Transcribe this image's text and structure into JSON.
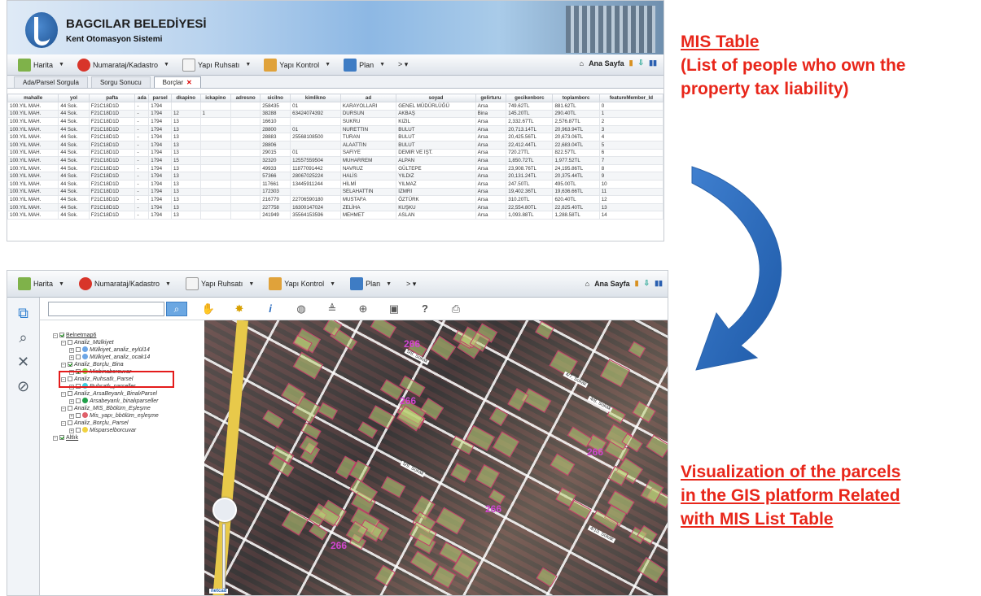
{
  "app": {
    "org": "BAGCILAR BELEDİYESİ",
    "subtitle": "Kent Otomasyon Sistemi"
  },
  "toolbar": {
    "items": [
      {
        "label": "Harita",
        "icon": "map-icon",
        "color": "#7fb24a"
      },
      {
        "label": "Numarataj/Kadastro",
        "icon": "pin-icon",
        "color": "#d8352a"
      },
      {
        "label": "Yapı Ruhsatı",
        "icon": "document-icon",
        "color": "#f4f4f4"
      },
      {
        "label": "Yapı Kontrol",
        "icon": "building-icon",
        "color": "#e0a23a"
      },
      {
        "label": "Plan",
        "icon": "plan-icon",
        "color": "#3e7cc4"
      }
    ],
    "more": "> ▾",
    "home": "Ana Sayfa"
  },
  "tabs": [
    "Ada/Parsel Sorgula",
    "Sorgu Sonucu",
    "Borçlar"
  ],
  "table": {
    "columns": [
      "mahalle",
      "yol",
      "pafta",
      "ada",
      "parsel",
      "dkapino",
      "ickapino",
      "adresno",
      "sicilno",
      "kimlikno",
      "ad",
      "soyad",
      "gelirturu",
      "gecikenborc",
      "toplamborc",
      "featureMember_Id"
    ],
    "rows": [
      [
        "100.YIL MAH.",
        "44 Sok.",
        "F21C18D1D",
        "-",
        "1794",
        "",
        "",
        "",
        "258435",
        "01",
        "KARAYOLLARI",
        "GENEL MÜDÜRLÜĞÜ",
        "Arsa",
        "749.62TL",
        "881.62TL",
        "0"
      ],
      [
        "100.YIL MAH.",
        "44 Sok.",
        "F21C18D1D",
        "-",
        "1794",
        "12",
        "1",
        "",
        "38288",
        "63424074392",
        "DURSUN",
        "AKBAŞ",
        "Bina",
        "145.20TL",
        "290.40TL",
        "1"
      ],
      [
        "100.YIL MAH.",
        "44 Sok.",
        "F21C18D1D",
        "-",
        "1794",
        "13",
        "",
        "",
        "16610",
        "",
        "SUKRU",
        "KIZIL",
        "Arsa",
        "2,332.67TL",
        "2,576.87TL",
        "2"
      ],
      [
        "100.YIL MAH.",
        "44 Sok.",
        "F21C18D1D",
        "-",
        "1794",
        "13",
        "",
        "",
        "28800",
        "01",
        "NURETTIN",
        "BULUT",
        "Arsa",
        "20,713.14TL",
        "20,963.94TL",
        "3"
      ],
      [
        "100.YIL MAH.",
        "44 Sok.",
        "F21C18D1D",
        "-",
        "1794",
        "13",
        "",
        "",
        "28883",
        "25568108500",
        "TURAN",
        "BULUT",
        "Arsa",
        "20,425.56TL",
        "20,673.06TL",
        "4"
      ],
      [
        "100.YIL MAH.",
        "44 Sok.",
        "F21C18D1D",
        "-",
        "1794",
        "13",
        "",
        "",
        "28806",
        "",
        "ALAATTIN",
        "BULUT",
        "Arsa",
        "22,412.44TL",
        "22,683.04TL",
        "5"
      ],
      [
        "100.YIL MAH.",
        "44 Sok.",
        "F21C18D1D",
        "-",
        "1794",
        "13",
        "",
        "",
        "29015",
        "01",
        "SAFIYE",
        "DEMİR VE İŞT.",
        "Arsa",
        "720.27TL",
        "822.57TL",
        "6"
      ],
      [
        "100.YIL MAH.",
        "44 Sok.",
        "F21C18D1D",
        "-",
        "1794",
        "15",
        "",
        "",
        "32320",
        "12557559504",
        "MUHARREM",
        "ALPAN",
        "Arsa",
        "1,850.72TL",
        "1,977.52TL",
        "7"
      ],
      [
        "100.YIL MAH.",
        "44 Sok.",
        "F21C18D1D",
        "-",
        "1794",
        "13",
        "",
        "",
        "49933",
        "11877091442",
        "NAVRUZ",
        "GÜLTEPE",
        "Arsa",
        "23,908.76TL",
        "24,195.86TL",
        "8"
      ],
      [
        "100.YIL MAH.",
        "44 Sok.",
        "F21C18D1D",
        "-",
        "1794",
        "13",
        "",
        "",
        "57366",
        "28067025224",
        "HALİS",
        "YILDIZ",
        "Arsa",
        "20,131.24TL",
        "20,375.44TL",
        "9"
      ],
      [
        "100.YIL MAH.",
        "44 Sok.",
        "F21C18D1D",
        "-",
        "1794",
        "13",
        "",
        "",
        "117661",
        "13445911244",
        "HİLMİ",
        "YILMAZ",
        "Arsa",
        "247.50TL",
        "495.00TL",
        "10"
      ],
      [
        "100.YIL MAH.",
        "44 Sok.",
        "F21C18D1D",
        "-",
        "1794",
        "13",
        "",
        "",
        "172303",
        "",
        "SELAHATTIN",
        "İZMRİ",
        "Arsa",
        "19,402.36TL",
        "19,636.66TL",
        "11"
      ],
      [
        "100.YIL MAH.",
        "44 Sok.",
        "F21C18D1D",
        "-",
        "1794",
        "13",
        "",
        "",
        "216779",
        "22706590180",
        "MUSTAFA",
        "ÖZTÜRK",
        "Arsa",
        "310.20TL",
        "620.40TL",
        "12"
      ],
      [
        "100.YIL MAH.",
        "44 Sok.",
        "F21C18D1D",
        "-",
        "1794",
        "13",
        "",
        "",
        "227758",
        "16300147024",
        "ZELİHA",
        "KUŞKU",
        "Arsa",
        "22,554.80TL",
        "22,825.40TL",
        "13"
      ],
      [
        "100.YIL MAH.",
        "44 Sok.",
        "F21C18D1D",
        "-",
        "1794",
        "13",
        "",
        "",
        "241949",
        "35564153596",
        "MEHMET",
        "ASLAN",
        "Arsa",
        "1,093.88TL",
        "1,288.58TL",
        "14"
      ]
    ]
  },
  "notes": {
    "t1_line1": "MIS Table",
    "t1_line2": "(List of people who own the",
    "t1_line3": "property tax liability)",
    "t2_line1": "Visualization of the parcels",
    "t2_line2": "in the GIS platform Related",
    "t2_line3": "with MIS  List Table"
  },
  "tree": [
    {
      "text": "Belnetmap6",
      "level": 0,
      "checked": true,
      "root": true
    },
    {
      "text": "Analiz_Mülkiyet",
      "level": 1,
      "checked": false
    },
    {
      "text": "Mülkiyet_analiz_eylül14",
      "level": 2,
      "checked": false,
      "color": "#6da6e6"
    },
    {
      "text": "Mülkiyet_analiz_ocak14",
      "level": 2,
      "checked": false,
      "color": "#6da6e6"
    },
    {
      "text": "Analiz_Borçlu_Bina",
      "level": 1,
      "checked": true
    },
    {
      "text": "Misbinaborcuvar",
      "level": 2,
      "checked": true,
      "color": "#8bd24c"
    },
    {
      "text": "Analiz_Ruhsatlı_Parsel",
      "level": 1,
      "checked": false
    },
    {
      "text": "Ruhsatlı_parseller",
      "level": 2,
      "checked": false,
      "color": "#3fd0e0"
    },
    {
      "text": "Analiz_ArsaBeyanlı_BinalıParsel",
      "level": 1,
      "checked": false
    },
    {
      "text": "Arsabeyanlı_binalıparseller",
      "level": 2,
      "checked": false,
      "color": "#22a04a"
    },
    {
      "text": "Analiz_MIS_Bbölüm_Eşleşme",
      "level": 1,
      "checked": false
    },
    {
      "text": "Mis_yapı_bbölüm_eşleşme",
      "level": 2,
      "checked": false,
      "color": "#e0606a"
    },
    {
      "text": "Analiz_Borçlu_Parsel",
      "level": 1,
      "checked": false
    },
    {
      "text": "Misparselborcuvar",
      "level": 2,
      "checked": false,
      "color": "#f0d240"
    },
    {
      "text": "Altlık",
      "level": 0,
      "checked": true,
      "root": true
    }
  ],
  "map": {
    "labels": [
      "266",
      "266",
      "266",
      "266",
      "266"
    ],
    "streets": [
      "4/7. Sokak",
      "4/8. Sokak",
      "5/8. Sokak",
      "5/9. Sokak",
      "4/10. Sokak"
    ],
    "credit": "netcad"
  }
}
